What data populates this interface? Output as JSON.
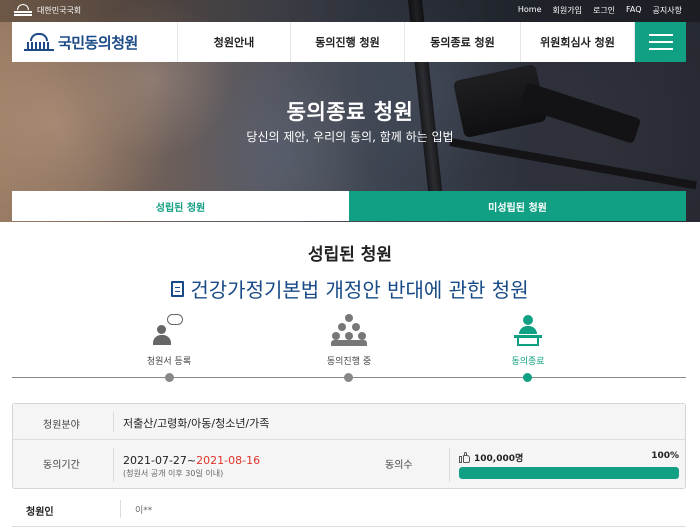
{
  "top_bar": {
    "assembly_label": "대한민국국회",
    "links": [
      "Home",
      "회원가입",
      "로그인",
      "FAQ",
      "공지사항"
    ]
  },
  "nav": {
    "logo_text": "국민동의청원",
    "items": [
      "청원안내",
      "동의진행 청원",
      "동의종료 청원",
      "위원회심사 청원"
    ],
    "menu_icon": "hamburger-icon"
  },
  "hero": {
    "title": "동의종료 청원",
    "subtitle": "당신의 제안, 우리의 동의, 함께 하는 입법"
  },
  "tabs": {
    "established": "성립된 청원",
    "not_established": "미성립된 청원",
    "active": "established"
  },
  "content": {
    "section_title": "성립된 청원",
    "petition_title": "건강가정기본법 개정안 반대에 관한 청원",
    "title_icon": "document-icon"
  },
  "steps": [
    {
      "label": "청원서 등록",
      "icon": "person-speech-icon",
      "current": false
    },
    {
      "label": "동의진행 중",
      "icon": "crowd-icon",
      "current": false
    },
    {
      "label": "동의종료",
      "icon": "podium-icon",
      "current": true
    }
  ],
  "info": {
    "category_label": "청원분야",
    "category_value": "저출산/고령화/아동/청소년/가족",
    "period_label": "동의기간",
    "period_start": "2021-07-27~",
    "period_end": "2021-08-16",
    "period_note": "(청원서 공개 이후 30일 이내)",
    "agree_label": "동의수",
    "agree_count": "100,000명",
    "agree_percent_text": "100%",
    "agree_fraction": 1.0
  },
  "petitioner": {
    "label": "청원인",
    "value": "이**"
  },
  "colors": {
    "accent": "#11a083",
    "title_blue": "#174a86",
    "end_date_red": "#e0352b"
  }
}
